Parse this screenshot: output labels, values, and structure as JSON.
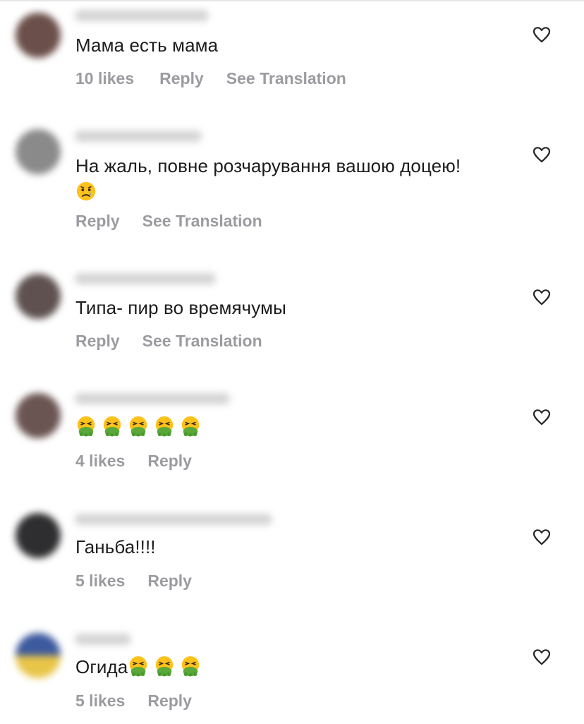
{
  "comments": [
    {
      "text": "Мама есть мама",
      "emoji": [],
      "likes": "10 likes",
      "reply": "Reply",
      "translation": "See Translation",
      "avatar_color": "#6b4f4a"
    },
    {
      "text": "На жаль, повне розчарування вашою доцею!",
      "emoji": [
        "crying-face"
      ],
      "likes": "",
      "reply": "Reply",
      "translation": "See Translation",
      "avatar_color": "#8a8a8a"
    },
    {
      "text": "Типа- пир во времячумы",
      "emoji": [],
      "likes": "",
      "reply": "Reply",
      "translation": "See Translation",
      "avatar_color": "#5e5150"
    },
    {
      "text": "",
      "emoji": [
        "vomiting-face",
        "vomiting-face",
        "vomiting-face",
        "vomiting-face",
        "vomiting-face"
      ],
      "likes": "4 likes",
      "reply": "Reply",
      "translation": "",
      "avatar_color": "#6a5552"
    },
    {
      "text": "Ганьба!!!!",
      "emoji": [],
      "likes": "5 likes",
      "reply": "Reply",
      "translation": "",
      "avatar_color": "#2e2e30"
    },
    {
      "text": "Огида",
      "emoji": [
        "vomiting-face",
        "vomiting-face",
        "vomiting-face"
      ],
      "likes": "5 likes",
      "reply": "Reply",
      "translation": "",
      "avatar_color": "#3d5a9e"
    }
  ],
  "icons": {
    "like": "heart-outline-icon"
  },
  "colors": {
    "text": "#1c1c1e",
    "secondary": "#9b9ba0",
    "background": "#ffffff"
  }
}
